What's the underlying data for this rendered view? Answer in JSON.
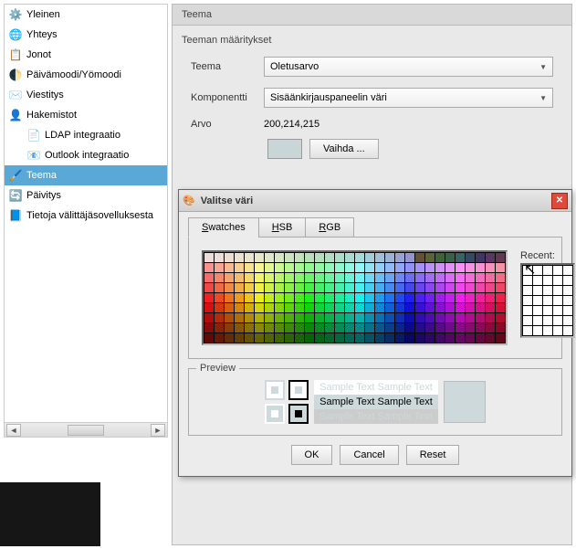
{
  "sidebar": {
    "items": [
      {
        "icon": "⚙️",
        "label": "Yleinen"
      },
      {
        "icon": "🌐",
        "label": "Yhteys"
      },
      {
        "icon": "📋",
        "label": "Jonot"
      },
      {
        "icon": "🌓",
        "label": "Päivämoodi/Yömoodi"
      },
      {
        "icon": "✉️",
        "label": "Viestitys"
      },
      {
        "icon": "👤",
        "label": "Hakemistot"
      },
      {
        "icon": "📄",
        "label": "LDAP integraatio",
        "child": true
      },
      {
        "icon": "📧",
        "label": "Outlook integraatio",
        "child": true
      },
      {
        "icon": "🖌️",
        "label": "Teema",
        "selected": true
      },
      {
        "icon": "🔄",
        "label": "Päivitys"
      },
      {
        "icon": "📘",
        "label": "Tietoja välittäjäsovelluksesta"
      }
    ]
  },
  "panel": {
    "title": "Teema",
    "group": "Teeman määritykset",
    "theme_label": "Teema",
    "theme_value": "Oletusarvo",
    "component_label": "Komponentti",
    "component_value": "Sisäänkirjauspaneelin väri",
    "value_label": "Arvo",
    "value_value": "200,214,215",
    "change_btn": "Vaihda ..."
  },
  "dialog": {
    "title": "Valitse väri",
    "tab_swatches": "Swatches",
    "tab_hsb": "HSB",
    "tab_rgb": "RGB",
    "recent_label": "Recent:",
    "preview_label": "Preview",
    "sample_text": "Sample Text Sample Text",
    "ok": "OK",
    "cancel": "Cancel",
    "reset": "Reset"
  },
  "swatch_colors": [
    "#ffffff",
    "#f0f0f0",
    "#e0e0e0",
    "#d0d0d0",
    "#c0c0c0",
    "#b0b0b0",
    "#a0a0a0",
    "#909090",
    "#808080",
    "#707070",
    "#606060",
    "#505050",
    "#404040",
    "#303030",
    "#202020",
    "#101010",
    "#000000",
    "#330000",
    "#660000",
    "#663300",
    "#666600",
    "#336600",
    "#006600",
    "#006633",
    "#006666",
    "#003366",
    "#000066",
    "#330066",
    "#660066",
    "#660033"
  ]
}
